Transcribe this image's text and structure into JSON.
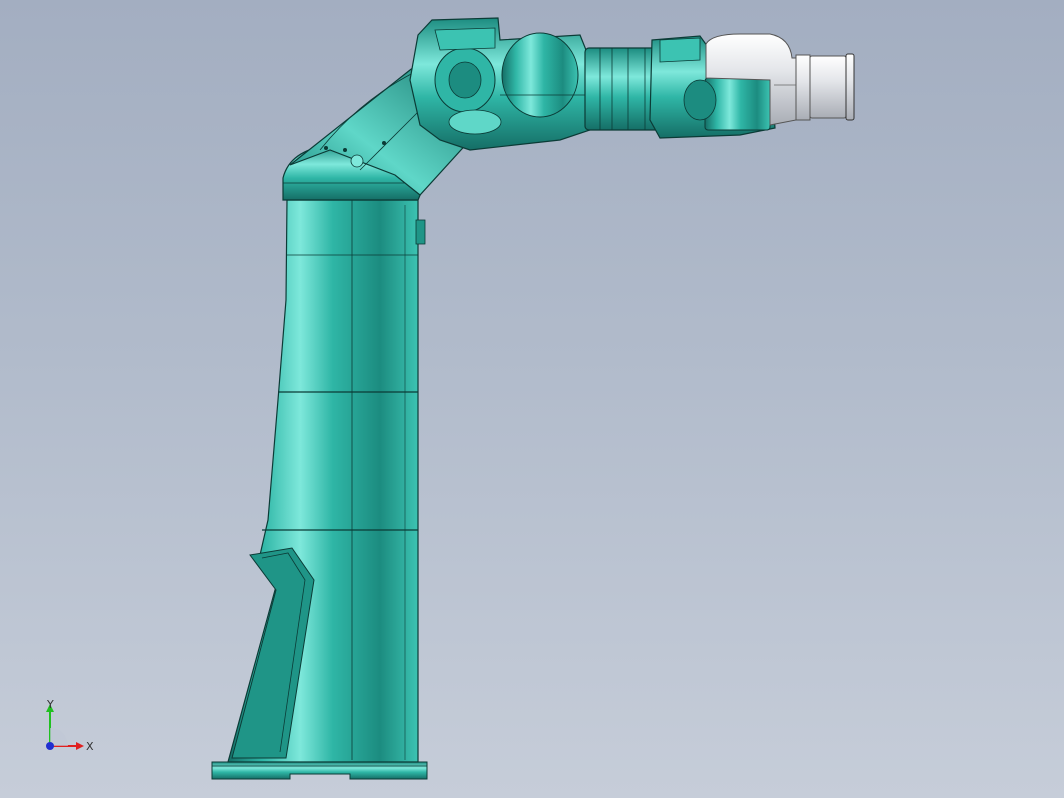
{
  "viewport": {
    "background_top": "#a3aec1",
    "background_bottom": "#c6cdd9"
  },
  "model": {
    "body_color": "#2fb6a6",
    "body_dark": "#156e66",
    "body_highlight": "#7ee8db",
    "tool_color": "#e4e6ea",
    "edge_color": "#0b3b36"
  },
  "triad": {
    "x_label": "X",
    "y_label": "Y",
    "x_color": "#e02020",
    "y_color": "#20c020",
    "origin_color": "#2030d0"
  }
}
